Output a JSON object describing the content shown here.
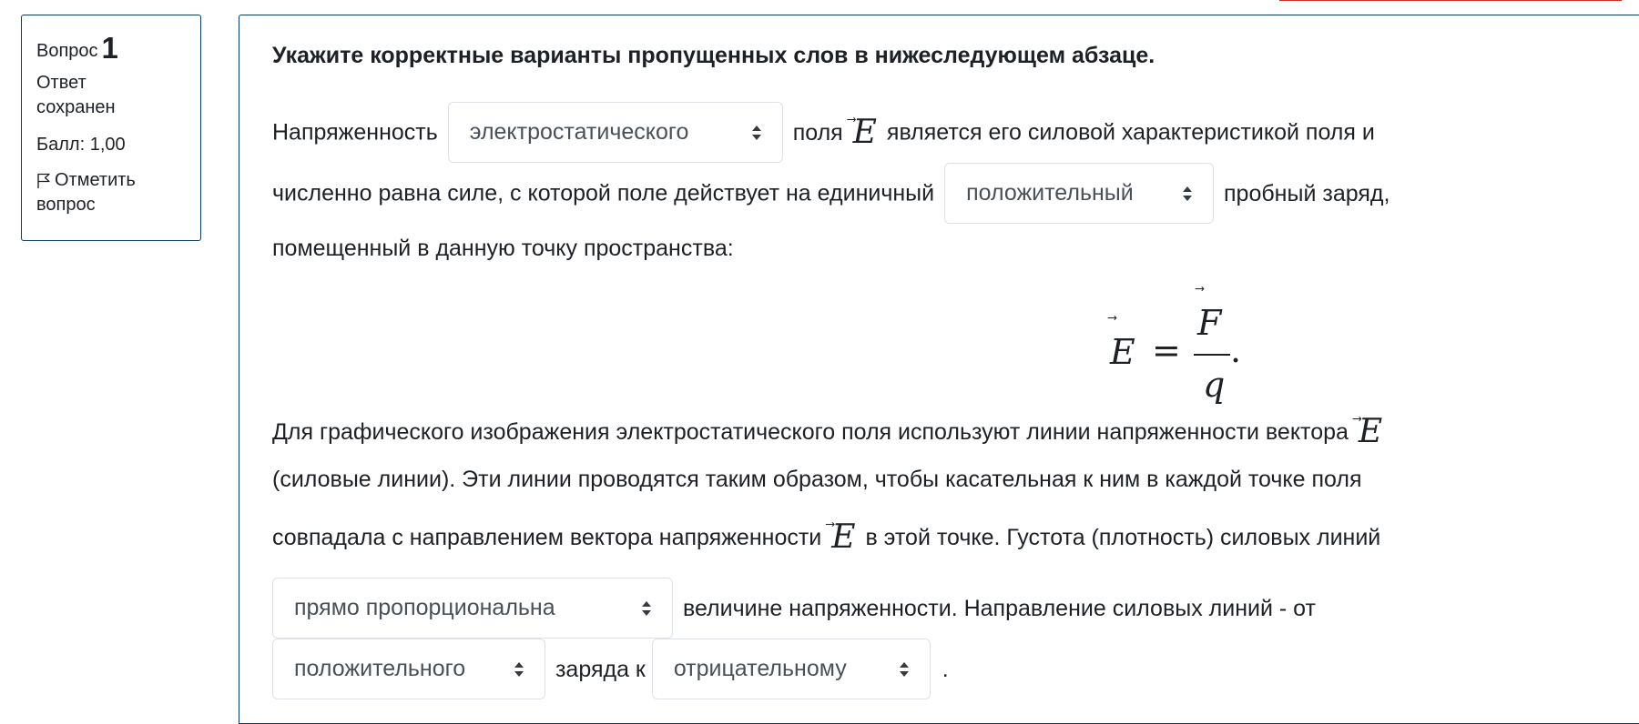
{
  "info": {
    "question_label": "Вопрос",
    "question_number": "1",
    "state": [
      "Ответ",
      "сохранен"
    ],
    "grade": "Балл: 1,00",
    "flag": [
      "Отметить",
      "вопрос"
    ]
  },
  "question": {
    "instruction": "Укажите корректные варианты пропущенных слов в нижеследующем абзаце.",
    "p1": {
      "t1": "Напряженность",
      "select1": "электростатического",
      "t2": "поля",
      "t3": "является его силовой характеристикой поля и",
      "t4": "численно равна силе, с которой поле действует на единичный",
      "select2": "положительный",
      "t5": "пробный заряд,",
      "t6": "помещенный в данную точку пространства:"
    },
    "formula": {
      "lhs": "E",
      "equals": "=",
      "numerator": "F",
      "denominator": "q",
      "period": "."
    },
    "p2": {
      "t1": "Для графического изображения электростатического поля используют линии напряженности вектора",
      "t2": "(силовые линии). Эти линии проводятся таким образом, чтобы касательная к ним в каждой точке поля",
      "t3": "совпадала с направлением вектора напряженности",
      "t4": "в этой точке. Густота (плотность) силовых линий",
      "select3": "прямо пропорциональна",
      "t5": "величине напряженности. Направление силовых линий - от",
      "select4": "положительного",
      "t6": "заряда к",
      "select5": "отрицательному",
      "t7": "."
    }
  }
}
